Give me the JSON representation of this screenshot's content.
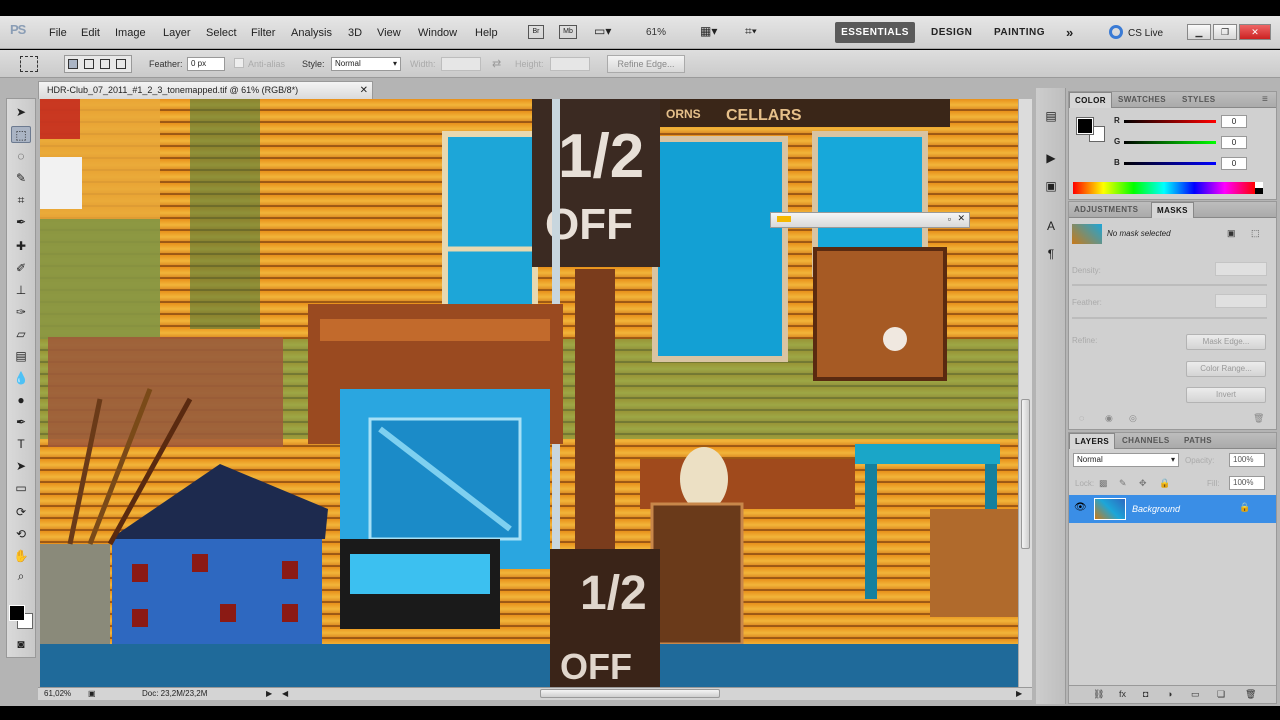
{
  "app": {
    "logo": "PS"
  },
  "menu": [
    "File",
    "Edit",
    "Image",
    "Layer",
    "Select",
    "Filter",
    "Analysis",
    "3D",
    "View",
    "Window",
    "Help"
  ],
  "appbar": {
    "zoom": "61%",
    "workspaces": [
      "ESSENTIALS",
      "DESIGN",
      "PAINTING"
    ],
    "more": "»",
    "cs_live": "CS Live"
  },
  "options": {
    "feather_label": "Feather:",
    "feather_value": "0 px",
    "antialias_label": "Anti-alias",
    "style_label": "Style:",
    "style_value": "Normal",
    "width_label": "Width:",
    "height_label": "Height:",
    "refine_edge": "Refine Edge..."
  },
  "document": {
    "tab_title": "HDR-Club_07_2011_#1_2_3_tonemapped.tif @ 61% (RGB/8*)"
  },
  "status": {
    "zoom": "61,02%",
    "doc": "Doc: 23,2M/23,2M"
  },
  "image_text": {
    "sign_half": "1/2",
    "sign_off": "OFF",
    "cellars": "CELLARS",
    "orns": "ORNS",
    "bottom_half": "1/2",
    "bottom_off": "OFF"
  },
  "color_panel": {
    "tabs": [
      "COLOR",
      "SWATCHES",
      "STYLES"
    ],
    "channels": [
      {
        "label": "R",
        "value": "0"
      },
      {
        "label": "G",
        "value": "0"
      },
      {
        "label": "B",
        "value": "0"
      }
    ]
  },
  "adjust_panel": {
    "tabs": [
      "ADJUSTMENTS",
      "MASKS"
    ],
    "mask_status": "No mask selected",
    "density_label": "Density:",
    "feather_label": "Feather:",
    "refine_label": "Refine:",
    "buttons": [
      "Mask Edge...",
      "Color Range...",
      "Invert"
    ]
  },
  "layers_panel": {
    "tabs": [
      "LAYERS",
      "CHANNELS",
      "PATHS"
    ],
    "blend_mode": "Normal",
    "opacity_label": "Opacity:",
    "opacity_value": "100%",
    "lock_label": "Lock:",
    "fill_label": "Fill:",
    "fill_value": "100%",
    "layers": [
      {
        "name": "Background"
      }
    ]
  },
  "colors": {
    "accent_selected": "#3a8ee6",
    "workspace_active": "#5a5a5a"
  }
}
